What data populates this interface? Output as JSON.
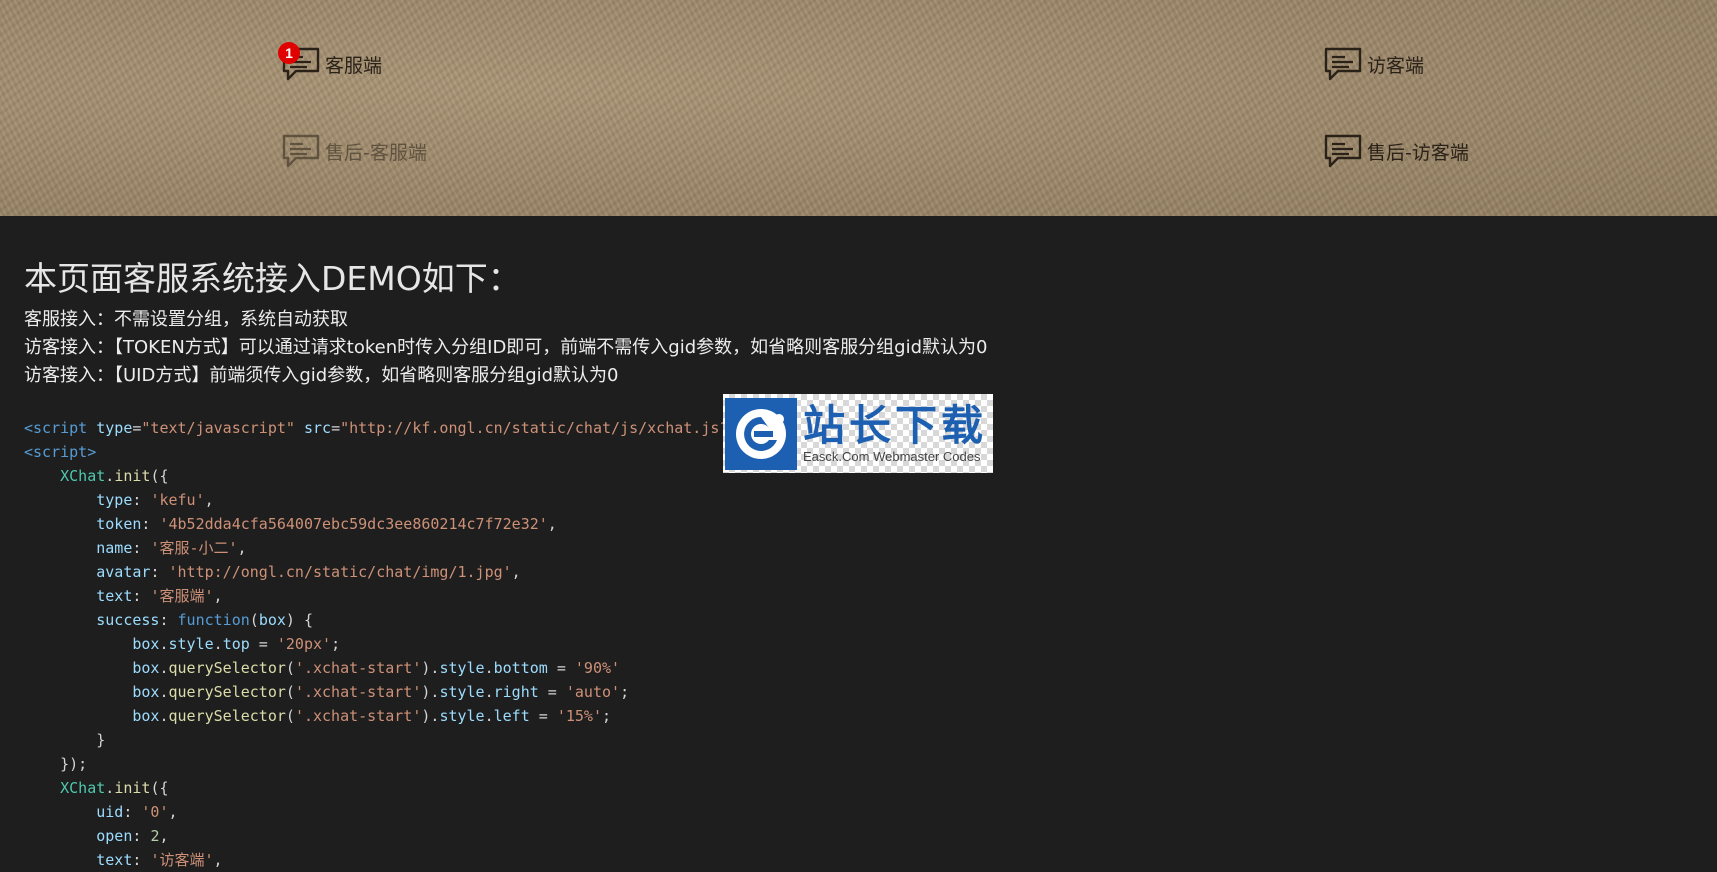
{
  "header": {
    "entries": [
      {
        "id": "kefu",
        "label": "客服端",
        "badge": "1"
      },
      {
        "id": "visitor",
        "label": "访客端"
      },
      {
        "id": "aftersale-kefu",
        "label": "售后-客服端"
      },
      {
        "id": "aftersale-visitor",
        "label": "售后-访客端"
      }
    ]
  },
  "main": {
    "heading": "本页面客服系统接入DEMO如下：",
    "notes": [
      "客服接入：不需设置分组，系统自动获取",
      "访客接入：【TOKEN方式】可以通过请求token时传入分组ID即可，前端不需传入gid参数，如省略则客服分组gid默认为0",
      "访客接入：【UID方式】前端须传入gid参数，如省略则客服分组gid默认为0"
    ]
  },
  "code": {
    "script_src": "\"http://kf.ongl.cn/static/chat/js/xchat.js?v",
    "token": "'4b52dda4cfa564007ebc59dc3ee860214c7f72e32'",
    "name": "'客服-小二'",
    "avatar": "'http://ongl.cn/static/chat/img/1.jpg'",
    "text1": "'客服端'",
    "top": "'20px'",
    "bottom": "'90%'",
    "right": "'auto'",
    "left": "'15%'",
    "uid": "'0'",
    "open": "2",
    "text2": "'访客端'"
  },
  "watermark": {
    "title": "站长下载",
    "subtitle": "Easck.Com Webmaster Codes"
  },
  "colors": {
    "header_bg": "#a08a6a",
    "page_bg": "#1e1e1e",
    "badge": "#e00000",
    "watermark_blue": "#1d5fb0"
  },
  "icons": {
    "chat": "speech-bubble-icon",
    "logo": "easck-e-logo"
  }
}
